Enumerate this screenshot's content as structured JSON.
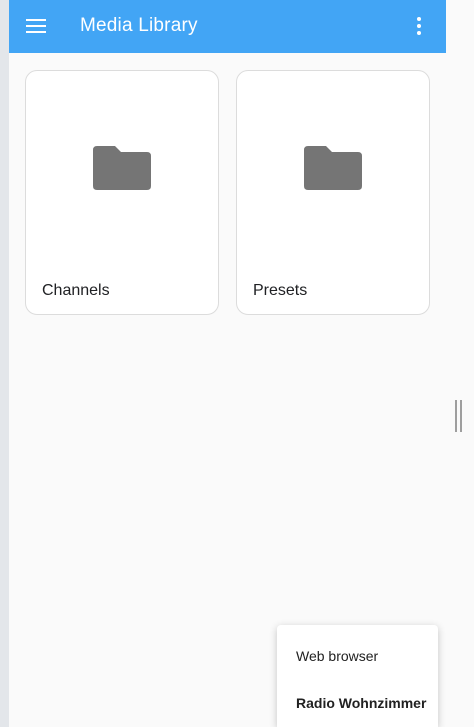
{
  "topbar": {
    "title": "Media Library",
    "menu_icon": "hamburger-menu-icon",
    "more_icon": "more-vert-icon",
    "color": "#42a5f5"
  },
  "cards": [
    {
      "label": "Channels",
      "icon": "folder-icon"
    },
    {
      "label": "Presets",
      "icon": "folder-icon"
    }
  ],
  "popup": {
    "items": [
      {
        "label": "Web browser",
        "selected": false
      },
      {
        "label": "Radio Wohnzimmer",
        "selected": true
      }
    ]
  },
  "colors": {
    "folder": "#757575",
    "background": "#fafafa"
  }
}
